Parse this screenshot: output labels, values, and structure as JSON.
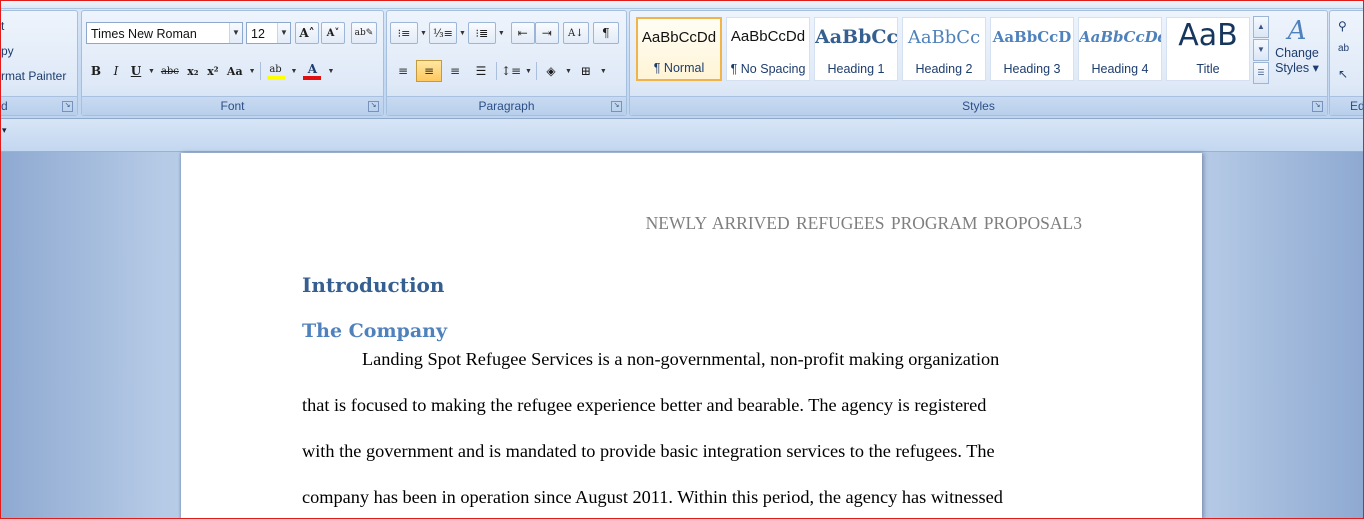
{
  "clipboard": {
    "cut_label": "t",
    "copy_label": "py",
    "format_painter_label": "rmat Painter",
    "group_label": "d"
  },
  "font": {
    "font_name": "Times New Roman",
    "font_size": "12",
    "group_label": "Font",
    "grow_icon": "A",
    "shrink_icon": "A",
    "bold": "B",
    "italic": "I",
    "underline": "U",
    "strike": "abc",
    "subscript": "x₂",
    "superscript": "x²",
    "change_case": "Aa",
    "highlight": "ab",
    "font_color": "A"
  },
  "paragraph": {
    "group_label": "Paragraph",
    "show_marks": "¶"
  },
  "styles": {
    "group_label": "Styles",
    "items": [
      {
        "sample": "AaBbCcDd",
        "name": "¶ Normal"
      },
      {
        "sample": "AaBbCcDd",
        "name": "¶ No Spacing"
      },
      {
        "sample": "AaBbCc",
        "name": "Heading 1"
      },
      {
        "sample": "AaBbCc",
        "name": "Heading 2"
      },
      {
        "sample": "AaBbCcD",
        "name": "Heading 3"
      },
      {
        "sample": "AaBbCcDd",
        "name": "Heading 4"
      },
      {
        "sample": "AaB",
        "name": "Title"
      }
    ],
    "change_styles_line1": "Change",
    "change_styles_line2": "Styles"
  },
  "editing": {
    "group_label": "Ed"
  },
  "document": {
    "header": "NEWLY ARRIVED REFUGEES PROGRAM PROPOSAL3",
    "heading1": "Introduction",
    "heading2": "The Company",
    "lines": [
      "Landing Spot Refugee Services is a non-governmental, non-profit making organization",
      "that is focused to making the refugee experience better and bearable. The agency is registered",
      "with the government and is mandated to provide basic integration services to the refugees. The",
      "company has been in operation since August 2011.  Within this period, the agency has witnessed"
    ]
  },
  "colors": {
    "highlight_yellow": "#ffff00",
    "font_color_red": "#e01010",
    "heading1": "#365f91",
    "heading2": "#4f81bd",
    "selected_style_border": "#f1b44a"
  }
}
